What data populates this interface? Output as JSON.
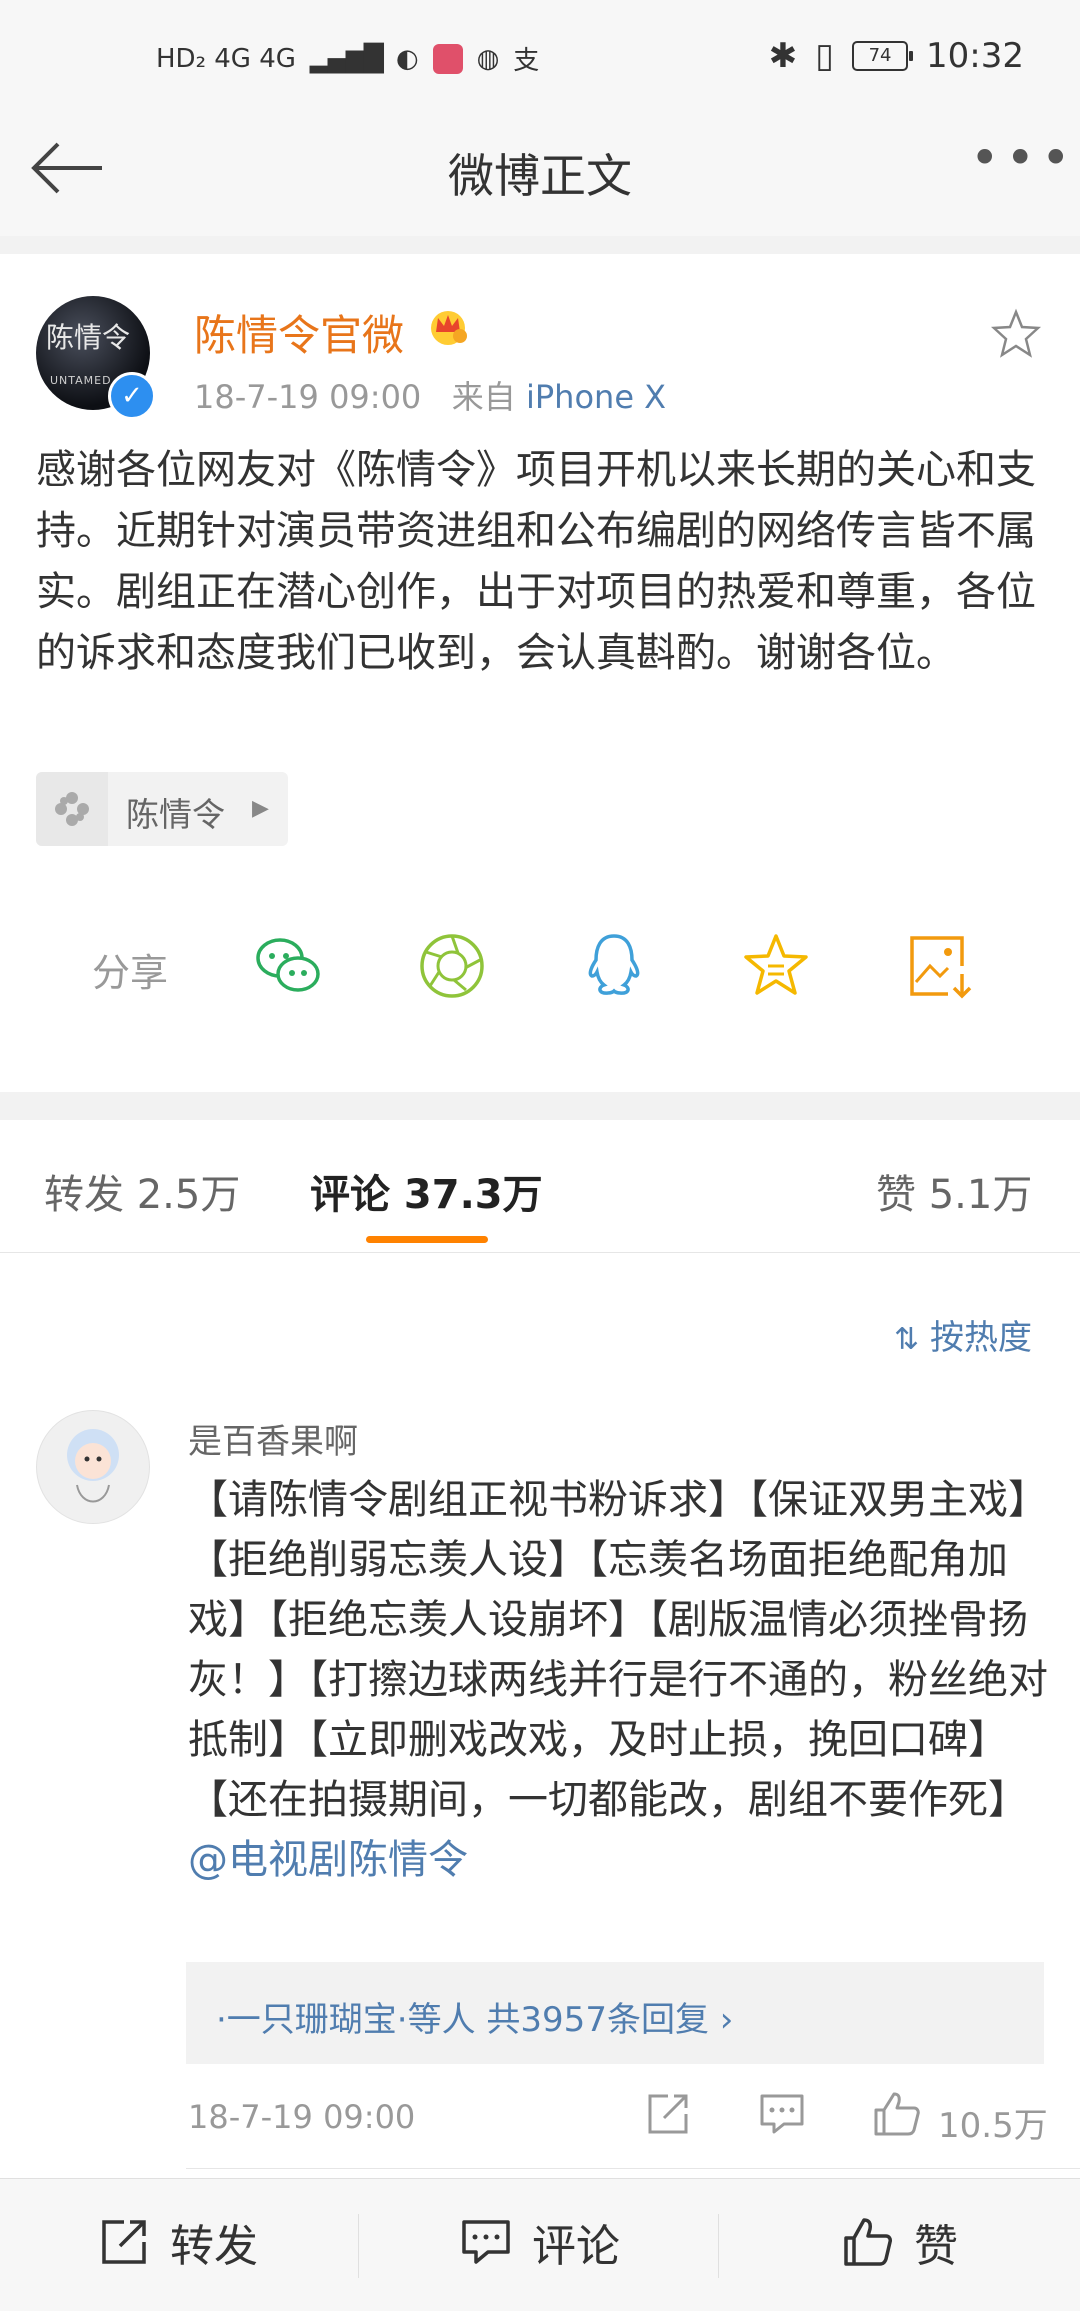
{
  "status_bar": {
    "left_indicators": "HD₂ 4G 4G",
    "battery": "74",
    "time": "10:32"
  },
  "nav": {
    "title": "微博正文"
  },
  "post": {
    "author": "陈情令官微",
    "timestamp": "18-7-19 09:00",
    "source_prefix": "来自",
    "source": "iPhone X",
    "avatar_text": "陈情令",
    "avatar_subtext": "UNTAMED",
    "text": "感谢各位网友对《陈情令》项目开机以来长期的关心和支持。近期针对演员带资进组和公布编剧的网络传言皆不属实。剧组正在潜心创作，出于对项目的热爱和尊重，各位的诉求和态度我们已收到，会认真斟酌。谢谢各位。",
    "topic": "陈情令",
    "share_label": "分享"
  },
  "tabs": {
    "repost": "转发 2.5万",
    "comments": "评论 37.3万",
    "likes": "赞 5.1万"
  },
  "sort_label": "按热度",
  "comment": {
    "username": "是百香果啊",
    "text": "【请陈情令剧组正视书粉诉求】【保证双男主戏】【拒绝削弱忘羡人设】【忘羡名场面拒绝配角加戏】【拒绝忘羡人设崩坏】【剧版温情必须挫骨扬灰！】【打擦边球两线并行是行不通的，粉丝绝对抵制】【立即删戏改戏，及时止损，挽回口碑】【还在拍摄期间，一切都能改，剧组不要作死】",
    "mention": "@电视剧陈情令",
    "replies": "·一只珊瑚宝·等人 共3957条回复 ›",
    "timestamp": "18-7-19 09:00",
    "like_count": "10.5万"
  },
  "toolbar": {
    "repost": "转发",
    "comment": "评论",
    "like": "赞"
  },
  "colors": {
    "author_orange": "#e8751a",
    "link_blue": "#507daf",
    "tab_underline": "#ff8200",
    "wechat_green": "#2bad5d",
    "moments_green": "#8fc43a",
    "qq_blue": "#3fa0d9",
    "star_yellow": "#f5b800",
    "save_orange": "#f29a0e"
  }
}
